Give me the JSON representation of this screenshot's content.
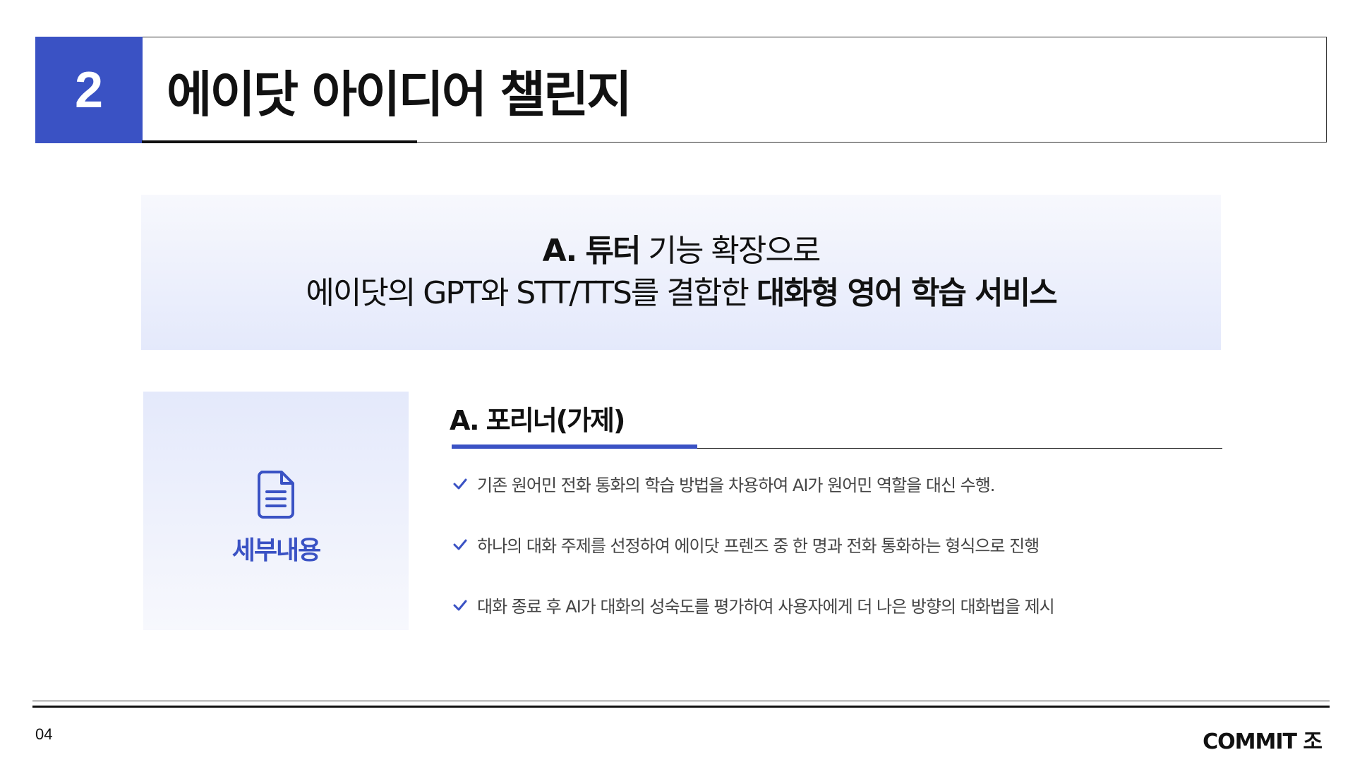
{
  "header": {
    "number": "2",
    "title": "에이닷 아이디어 챌린지"
  },
  "hero": {
    "line1_bold": "A. 튜터",
    "line1_rest": " 기능 확장으로",
    "line2_rest": "에이닷의 GPT와 STT/TTS를 결합한 ",
    "line2_bold": "대화형 영어 학습 서비스"
  },
  "detail_card": {
    "icon": "document-icon",
    "label": "세부내용"
  },
  "section": {
    "title": "A. 포리너(가제)",
    "bullets": [
      "기존 원어민 전화 통화의 학습 방법을 차용하여 AI가 원어민 역할을 대신 수행.",
      "하나의 대화 주제를 선정하여 에이닷 프렌즈 중 한 명과 전화 통화하는 형식으로 진행",
      "대화 종료 후 AI가 대화의 성숙도를 평가하여 사용자에게 더 나은 방향의 대화법을 제시"
    ]
  },
  "footer": {
    "page_number": "04",
    "brand": "COMMIT 조"
  },
  "colors": {
    "accent": "#3a52c4",
    "hero_bg_top": "#f7f8fd",
    "hero_bg_bottom": "#e4e9fb"
  }
}
